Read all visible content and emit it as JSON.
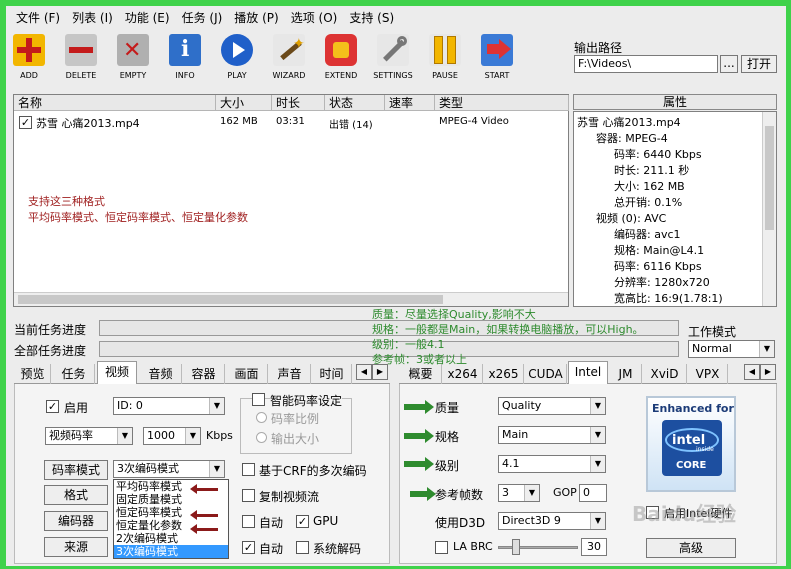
{
  "menu": [
    "文件 (F)",
    "列表 (I)",
    "功能 (E)",
    "任务 (J)",
    "播放 (P)",
    "选项 (O)",
    "支持 (S)"
  ],
  "toolbar": [
    {
      "label": "ADD",
      "icon": "add-icon"
    },
    {
      "label": "DELETE",
      "icon": "delete-icon"
    },
    {
      "label": "EMPTY",
      "icon": "empty-icon"
    },
    {
      "label": "INFO",
      "icon": "info-icon"
    },
    {
      "label": "PLAY",
      "icon": "play-icon"
    },
    {
      "label": "WIZARD",
      "icon": "wizard-icon"
    },
    {
      "label": "EXTEND",
      "icon": "extend-icon"
    },
    {
      "label": "SETTINGS",
      "icon": "settings-icon"
    },
    {
      "label": "PAUSE",
      "icon": "pause-icon"
    },
    {
      "label": "START",
      "icon": "start-icon"
    }
  ],
  "output": {
    "label": "输出路径",
    "path": "F:\\Videos\\",
    "browse": "...",
    "open": "打开"
  },
  "filelist": {
    "headers": [
      "名称",
      "大小",
      "时长",
      "状态",
      "速率",
      "类型"
    ],
    "row": {
      "name": "苏雪 心痛2013.mp4",
      "size": "162 MB",
      "duration": "03:31",
      "status": "出错 (14)",
      "rate": "",
      "type": "MPEG-4 Video"
    }
  },
  "annotation": {
    "line1": "支持这三种格式",
    "line2": "平均码率模式、恒定码率模式、恒定量化参数"
  },
  "props": {
    "title": "属性",
    "items": [
      "苏雪 心痛2013.mp4",
      "容器: MPEG-4",
      "码率: 6440 Kbps",
      "时长: 211.1 秒",
      "大小: 162 MB",
      "总开销: 0.1%",
      "视频 (0): AVC",
      "编码器: avc1",
      "规格: Main@L4.1",
      "码率: 6116 Kbps",
      "分辨率: 1280x720",
      "宽高比: 16:9(1.78:1)"
    ]
  },
  "progress": {
    "current": "当前任务进度",
    "all": "全部任务进度"
  },
  "notes": [
    "质量：尽量选择Quality,影响不大",
    "规格：一般都是Main，如果转换电脑播放，可以High。",
    "级别：一般4.1",
    "参考帧：3或者以上"
  ],
  "workmode": {
    "label": "工作模式",
    "value": "Normal"
  },
  "left_tabs": [
    "预览",
    "任务",
    "视频",
    "音频",
    "容器",
    "画面",
    "声音",
    "时间"
  ],
  "video": {
    "enable": "启用",
    "id": "ID: 0",
    "mode": "视频码率",
    "bitrate": "1000",
    "unit": "Kbps",
    "smart": "智能码率设定",
    "ratio": "码率比例",
    "outsize": "输出大小",
    "rc_btn": "码率模式",
    "rc_value": "3次编码模式",
    "crf": "基于CRF的多次编码",
    "format_btn": "格式",
    "copy": "复制视频流",
    "encoder_btn": "编码器",
    "auto1": "自动",
    "gpu": "GPU",
    "source_btn": "来源",
    "auto2": "自动",
    "sysdecode": "系统解码",
    "dropdown": [
      "平均码率模式",
      "固定质量模式",
      "恒定码率模式",
      "恒定量化参数",
      "2次编码模式",
      "3次编码模式"
    ]
  },
  "right_tabs": [
    "概要",
    "x264",
    "x265",
    "CUDA",
    "Intel",
    "JM",
    "XviD",
    "VPX"
  ],
  "intel": {
    "quality_label": "质量",
    "quality": "Quality",
    "profile_label": "规格",
    "profile": "Main",
    "level_label": "级别",
    "level": "4.1",
    "ref_label": "参考帧数",
    "ref": "3",
    "gop_label": "GOP",
    "gop": "0",
    "d3d_label": "使用D3D",
    "d3d": "Direct3D 9",
    "labrc": "LA BRC",
    "slider_val": "30",
    "advanced": "高级",
    "logo_top": "Enhanced for",
    "logo_brand": "intel",
    "logo_inside": "inside",
    "logo_core": "CORE",
    "extra_chk": "启用Intel硬件"
  },
  "watermark": "Baidu经验"
}
